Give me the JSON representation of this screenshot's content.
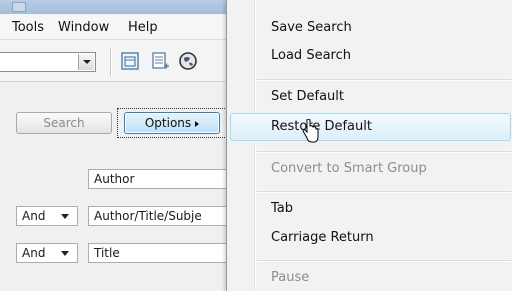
{
  "menubar": {
    "items": [
      "Tools",
      "Window",
      "Help"
    ]
  },
  "search": {
    "search_label": "Search",
    "options_label": "Options"
  },
  "rows": [
    {
      "bool": "",
      "field": "Author"
    },
    {
      "bool": "And",
      "field": "Author/Title/Subje"
    },
    {
      "bool": "And",
      "field": "Title"
    }
  ],
  "menu": {
    "items": [
      {
        "label": "Save Search",
        "enabled": true
      },
      {
        "label": "Load Search",
        "enabled": true
      },
      {
        "label": "Set Default",
        "enabled": true
      },
      {
        "label": "Restore Default",
        "enabled": true,
        "hovered": true
      },
      {
        "label": "Convert to Smart Group",
        "enabled": false
      },
      {
        "label": "Tab",
        "enabled": true
      },
      {
        "label": "Carriage Return",
        "enabled": true
      },
      {
        "label": "Pause",
        "enabled": false
      }
    ]
  },
  "colors": {
    "hover_border": "#a8d8eb",
    "options_border": "#3c7fb1",
    "disabled_text": "#8d8d8d"
  },
  "icons": [
    "combo-arrow-icon",
    "layout-icon",
    "document-list-icon",
    "globe-icon",
    "submenu-arrow-icon",
    "dropdown-arrow-icon",
    "pointer-cursor-icon"
  ]
}
